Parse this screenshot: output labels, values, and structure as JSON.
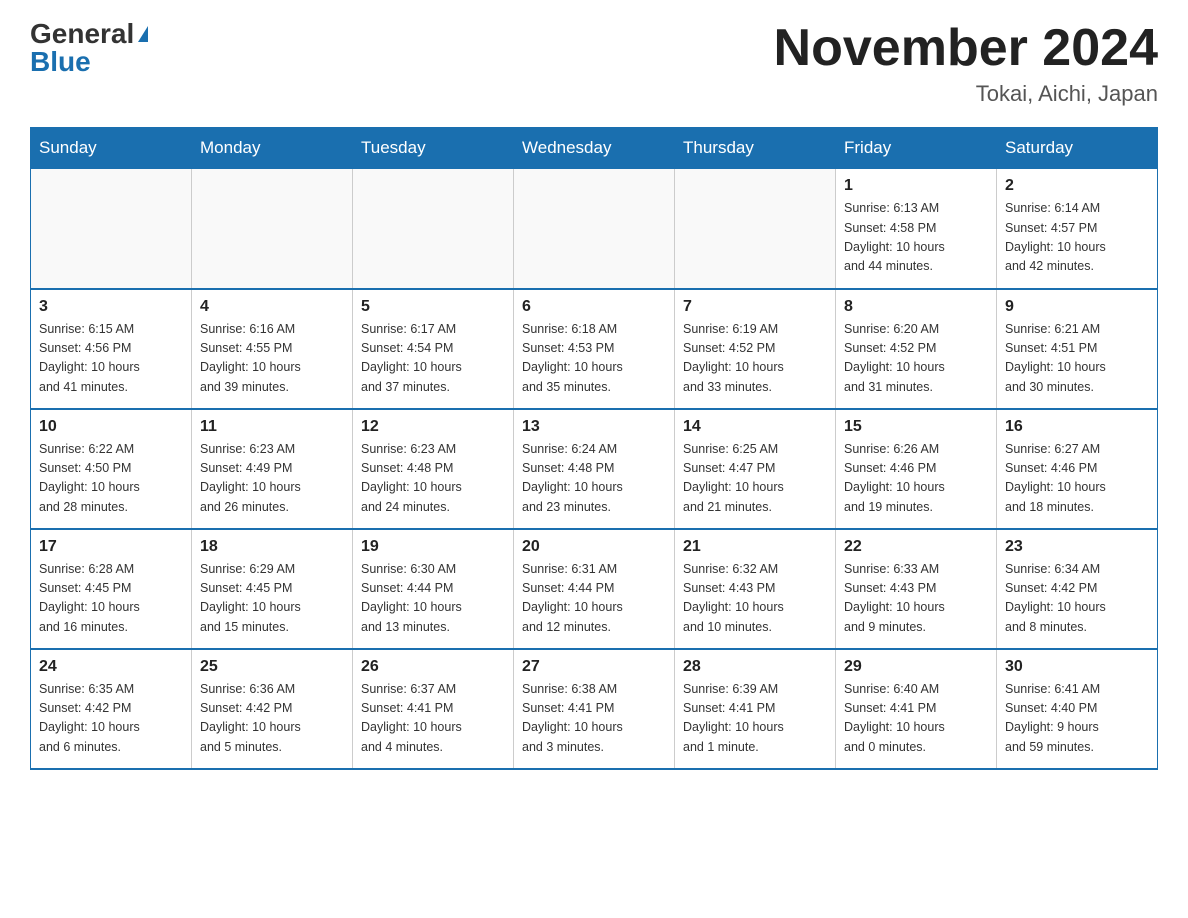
{
  "logo": {
    "general": "General",
    "blue": "Blue"
  },
  "title": "November 2024",
  "location": "Tokai, Aichi, Japan",
  "days_of_week": [
    "Sunday",
    "Monday",
    "Tuesday",
    "Wednesday",
    "Thursday",
    "Friday",
    "Saturday"
  ],
  "weeks": [
    [
      {
        "day": "",
        "info": ""
      },
      {
        "day": "",
        "info": ""
      },
      {
        "day": "",
        "info": ""
      },
      {
        "day": "",
        "info": ""
      },
      {
        "day": "",
        "info": ""
      },
      {
        "day": "1",
        "info": "Sunrise: 6:13 AM\nSunset: 4:58 PM\nDaylight: 10 hours\nand 44 minutes."
      },
      {
        "day": "2",
        "info": "Sunrise: 6:14 AM\nSunset: 4:57 PM\nDaylight: 10 hours\nand 42 minutes."
      }
    ],
    [
      {
        "day": "3",
        "info": "Sunrise: 6:15 AM\nSunset: 4:56 PM\nDaylight: 10 hours\nand 41 minutes."
      },
      {
        "day": "4",
        "info": "Sunrise: 6:16 AM\nSunset: 4:55 PM\nDaylight: 10 hours\nand 39 minutes."
      },
      {
        "day": "5",
        "info": "Sunrise: 6:17 AM\nSunset: 4:54 PM\nDaylight: 10 hours\nand 37 minutes."
      },
      {
        "day": "6",
        "info": "Sunrise: 6:18 AM\nSunset: 4:53 PM\nDaylight: 10 hours\nand 35 minutes."
      },
      {
        "day": "7",
        "info": "Sunrise: 6:19 AM\nSunset: 4:52 PM\nDaylight: 10 hours\nand 33 minutes."
      },
      {
        "day": "8",
        "info": "Sunrise: 6:20 AM\nSunset: 4:52 PM\nDaylight: 10 hours\nand 31 minutes."
      },
      {
        "day": "9",
        "info": "Sunrise: 6:21 AM\nSunset: 4:51 PM\nDaylight: 10 hours\nand 30 minutes."
      }
    ],
    [
      {
        "day": "10",
        "info": "Sunrise: 6:22 AM\nSunset: 4:50 PM\nDaylight: 10 hours\nand 28 minutes."
      },
      {
        "day": "11",
        "info": "Sunrise: 6:23 AM\nSunset: 4:49 PM\nDaylight: 10 hours\nand 26 minutes."
      },
      {
        "day": "12",
        "info": "Sunrise: 6:23 AM\nSunset: 4:48 PM\nDaylight: 10 hours\nand 24 minutes."
      },
      {
        "day": "13",
        "info": "Sunrise: 6:24 AM\nSunset: 4:48 PM\nDaylight: 10 hours\nand 23 minutes."
      },
      {
        "day": "14",
        "info": "Sunrise: 6:25 AM\nSunset: 4:47 PM\nDaylight: 10 hours\nand 21 minutes."
      },
      {
        "day": "15",
        "info": "Sunrise: 6:26 AM\nSunset: 4:46 PM\nDaylight: 10 hours\nand 19 minutes."
      },
      {
        "day": "16",
        "info": "Sunrise: 6:27 AM\nSunset: 4:46 PM\nDaylight: 10 hours\nand 18 minutes."
      }
    ],
    [
      {
        "day": "17",
        "info": "Sunrise: 6:28 AM\nSunset: 4:45 PM\nDaylight: 10 hours\nand 16 minutes."
      },
      {
        "day": "18",
        "info": "Sunrise: 6:29 AM\nSunset: 4:45 PM\nDaylight: 10 hours\nand 15 minutes."
      },
      {
        "day": "19",
        "info": "Sunrise: 6:30 AM\nSunset: 4:44 PM\nDaylight: 10 hours\nand 13 minutes."
      },
      {
        "day": "20",
        "info": "Sunrise: 6:31 AM\nSunset: 4:44 PM\nDaylight: 10 hours\nand 12 minutes."
      },
      {
        "day": "21",
        "info": "Sunrise: 6:32 AM\nSunset: 4:43 PM\nDaylight: 10 hours\nand 10 minutes."
      },
      {
        "day": "22",
        "info": "Sunrise: 6:33 AM\nSunset: 4:43 PM\nDaylight: 10 hours\nand 9 minutes."
      },
      {
        "day": "23",
        "info": "Sunrise: 6:34 AM\nSunset: 4:42 PM\nDaylight: 10 hours\nand 8 minutes."
      }
    ],
    [
      {
        "day": "24",
        "info": "Sunrise: 6:35 AM\nSunset: 4:42 PM\nDaylight: 10 hours\nand 6 minutes."
      },
      {
        "day": "25",
        "info": "Sunrise: 6:36 AM\nSunset: 4:42 PM\nDaylight: 10 hours\nand 5 minutes."
      },
      {
        "day": "26",
        "info": "Sunrise: 6:37 AM\nSunset: 4:41 PM\nDaylight: 10 hours\nand 4 minutes."
      },
      {
        "day": "27",
        "info": "Sunrise: 6:38 AM\nSunset: 4:41 PM\nDaylight: 10 hours\nand 3 minutes."
      },
      {
        "day": "28",
        "info": "Sunrise: 6:39 AM\nSunset: 4:41 PM\nDaylight: 10 hours\nand 1 minute."
      },
      {
        "day": "29",
        "info": "Sunrise: 6:40 AM\nSunset: 4:41 PM\nDaylight: 10 hours\nand 0 minutes."
      },
      {
        "day": "30",
        "info": "Sunrise: 6:41 AM\nSunset: 4:40 PM\nDaylight: 9 hours\nand 59 minutes."
      }
    ]
  ]
}
